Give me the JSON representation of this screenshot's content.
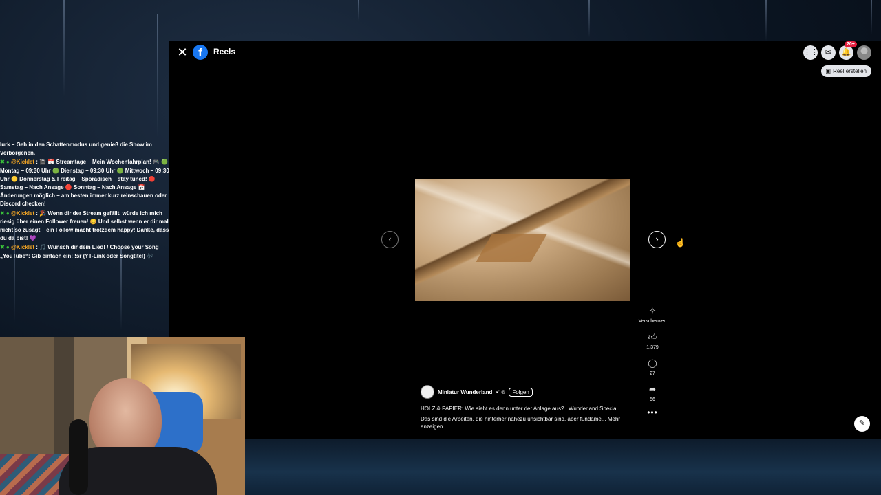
{
  "facebook": {
    "title": "Reels",
    "logo_letter": "f",
    "notification_badge": "20+",
    "create_reel_label": "Reel erstellen",
    "author": {
      "name": "Miniatur Wunderland",
      "follow_label": "Folgen"
    },
    "caption_title": "HOLZ & PAPIER: Wie sieht es denn unter der Anlage aus? | Wunderland Special",
    "caption_text": "Das sind die Arbeiten, die hinterher nahezu unsichtbar sind, aber fundame... Mehr anzeigen",
    "actions": {
      "gift_label": "Verschenken",
      "likes": "1.379",
      "comments": "27",
      "shares": "56"
    }
  },
  "stream_chat": [
    {
      "user": "",
      "text": "lurk – Geh in den Schattenmodus und genieß die Show im Verborgenen."
    },
    {
      "user": "@Kicklet",
      "text": ": 🎬 📅 Streamtage – Mein Wochenfahrplan! 🎮 🟢 Montag – 09:30 Uhr 🟢 Dienstag – 09:30 Uhr 🟢 Mittwoch – 09:30 Uhr 🟡 Donnerstag & Freitag – Sporadisch – stay tuned! 🔴 Samstag – Nach Ansage 🔴 Sonntag – Nach Ansage 📅 Änderungen möglich – am besten immer kurz reinschauen oder Discord checken!"
    },
    {
      "user": "@Kicklet",
      "text": ": 🎉 Wenn dir der Stream gefällt, würde ich mich riesig über einen Follower freuen! 😊 Und selbst wenn er dir mal nicht so zusagt – ein Follow macht trotzdem happy! Danke, dass du da bist! 💜"
    },
    {
      "user": "@Kicklet",
      "text": ": 🎵 Wünsch dir dein Lied! / Choose your Song „YouTube“: Gib einfach ein: !sr (YT-Link oder Songtitel) 🎶"
    }
  ]
}
